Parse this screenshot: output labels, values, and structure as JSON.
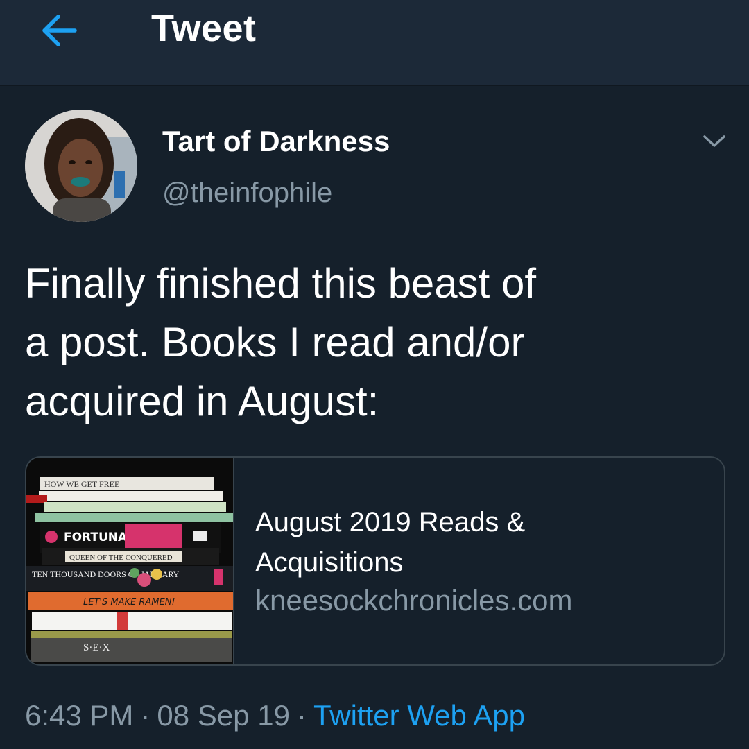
{
  "header": {
    "title": "Tweet",
    "back_icon": "arrow-left-icon",
    "accent_color": "#1da1f2"
  },
  "author": {
    "display_name": "Tart of Darkness",
    "handle": "@theinfophile"
  },
  "tweet": {
    "lines": [
      "Finally finished this beast of",
      "a post. Books I read and/or",
      "acquired in August:"
    ]
  },
  "link_card": {
    "title_lines": [
      "August 2019 Reads &",
      "Acquisitions"
    ],
    "domain": "kneesockchronicles.com",
    "image_spines": [
      "HOW WE GET FREE",
      "FORTUNA",
      "QUEEN OF THE CONQUERED",
      "TEN THOUSAND DOORS OF JANUARY",
      "LET'S MAKE RAMEN!",
      "S·E·X"
    ]
  },
  "meta": {
    "time": "6:43 PM",
    "date": "08 Sep 19",
    "separator": "·",
    "source": "Twitter Web App"
  },
  "colors": {
    "background": "#15202b",
    "header_bg": "#1c2938",
    "secondary_text": "#8899a6",
    "border": "#38444d"
  }
}
